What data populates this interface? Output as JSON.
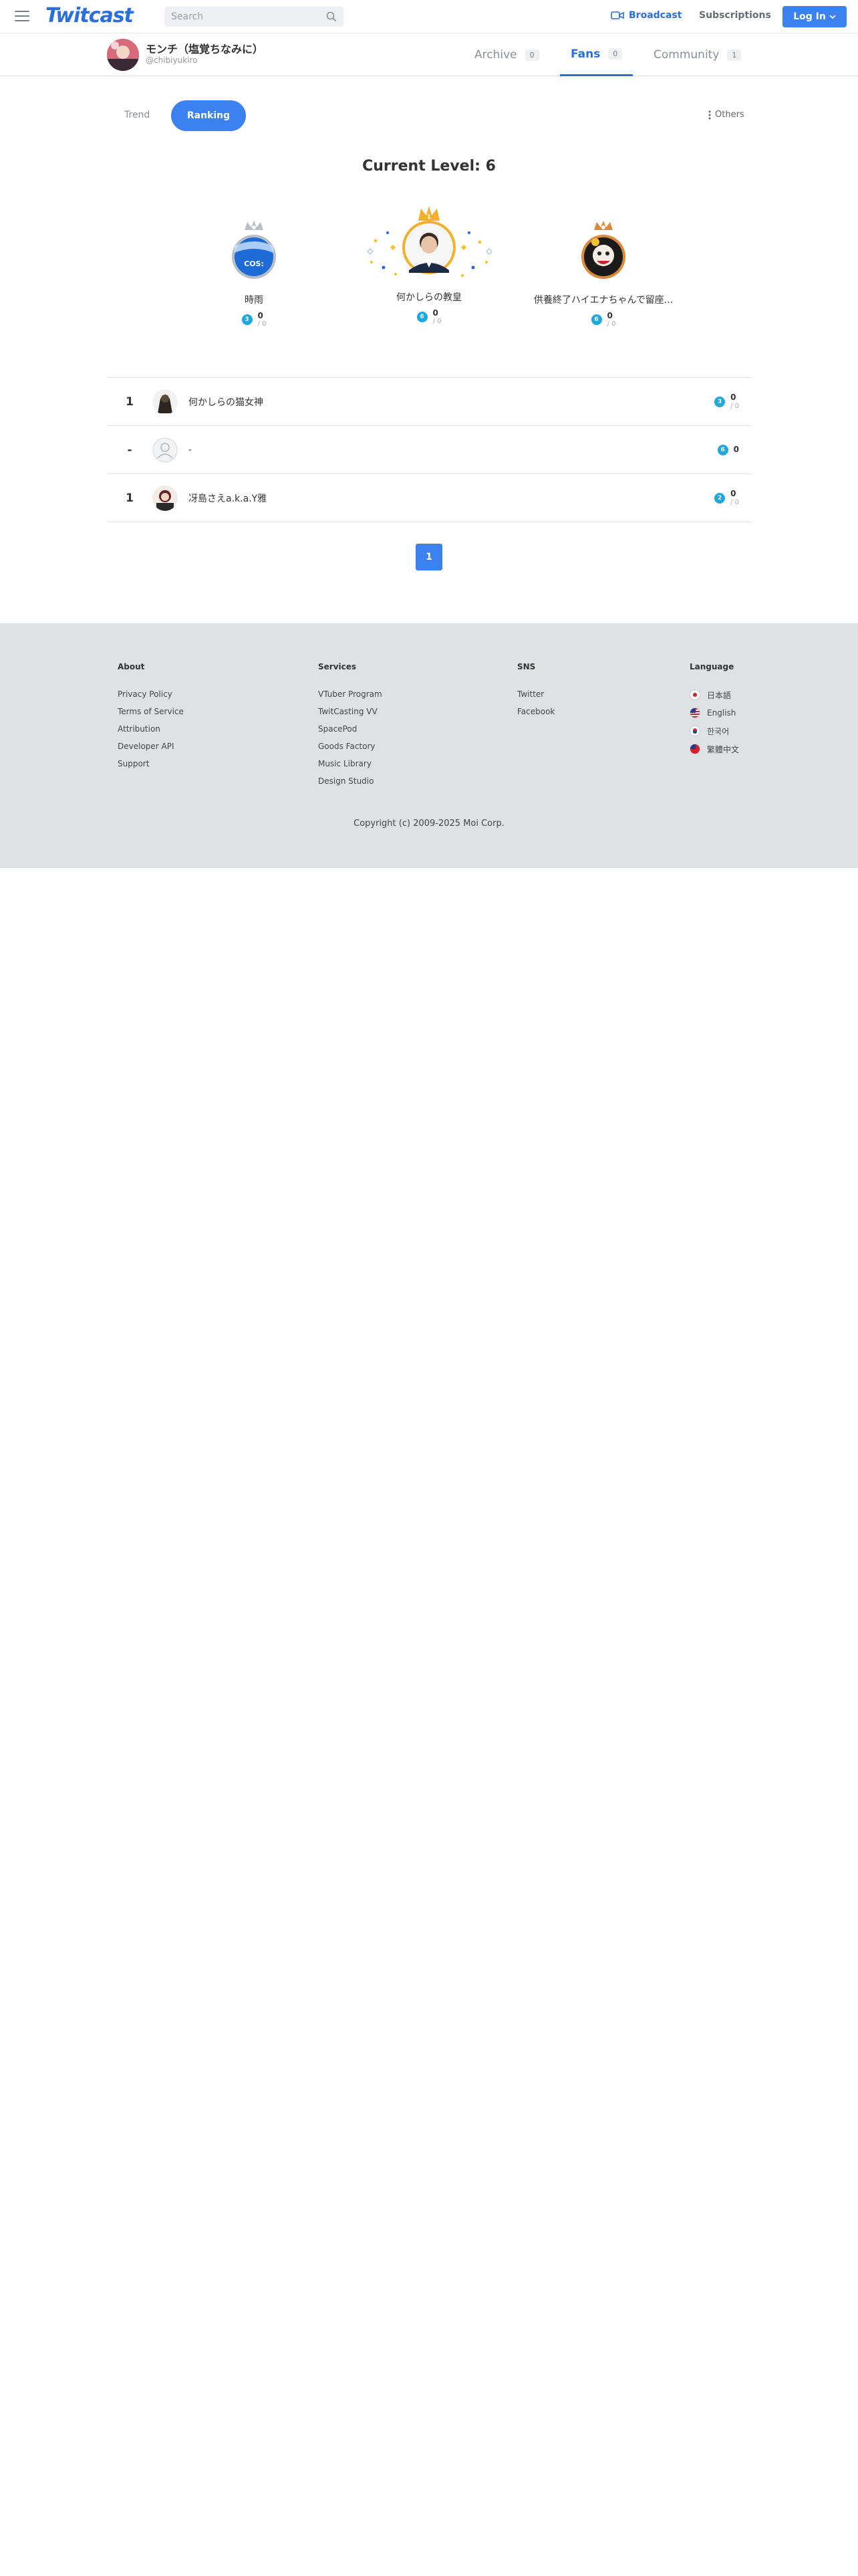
{
  "header": {
    "logo": "Twitcast",
    "search_placeholder": "Search",
    "broadcast_label": "Broadcast",
    "subscriptions_label": "Subscriptions",
    "login_label": "Log In"
  },
  "user": {
    "name": "モンチ（塩覚​ちなみに）",
    "handle": "@chibiyukiro"
  },
  "tabs": [
    {
      "label": "Archive",
      "count": "0"
    },
    {
      "label": "Fans",
      "count": "0"
    },
    {
      "label": "Community",
      "count": "1"
    }
  ],
  "subtabs": {
    "trend": "Trend",
    "ranking": "Ranking",
    "others": "Others"
  },
  "level_title": "Current Level: 6",
  "podium": [
    {
      "name": "時雨",
      "value": "0",
      "sub": "/ 0",
      "coin": "3",
      "crown": "silver",
      "badge_text": "COS:"
    },
    {
      "name": "何かしらの教皇",
      "value": "0",
      "sub": "/ 0",
      "coin": "6",
      "crown": "gold"
    },
    {
      "name": "​供養終了​ハイエナちゃんで留座...",
      "value": "0",
      "sub": "/ 0",
      "coin": "6",
      "crown": "bronze"
    }
  ],
  "ranking_rows": [
    {
      "rank": "1",
      "name": "何かしらの猫女神",
      "value": "0",
      "sub": "/ 0",
      "coin": "3"
    },
    {
      "rank": "-",
      "name": "-",
      "value": "0",
      "sub": "",
      "coin": "6"
    },
    {
      "rank": "1",
      "name": "冴島さえa.k.a.Y雅",
      "value": "0",
      "sub": "/ 0",
      "coin": "2"
    }
  ],
  "pagination": {
    "current": "1"
  },
  "footer": {
    "about": {
      "title": "About",
      "links": [
        "Privacy Policy",
        "Terms of Service",
        "Attribution",
        "Developer API",
        "Support"
      ]
    },
    "services": {
      "title": "Services",
      "links": [
        "VTuber Program",
        "TwitCasting VV",
        "SpacePod",
        "Goods Factory",
        "Music Library",
        "Design Studio"
      ]
    },
    "sns": {
      "title": "SNS",
      "links": [
        "Twitter",
        "Facebook"
      ]
    },
    "language": {
      "title": "Language",
      "links": [
        "日本語",
        "English",
        "한국어",
        "繁體中文"
      ]
    },
    "copyright": "Copyright (c) 2009-2025 Moi Corp."
  },
  "colors": {
    "accent": "#3b82f0",
    "coin": "#1fa8e0",
    "footer_bg": "#dfe2e5"
  }
}
